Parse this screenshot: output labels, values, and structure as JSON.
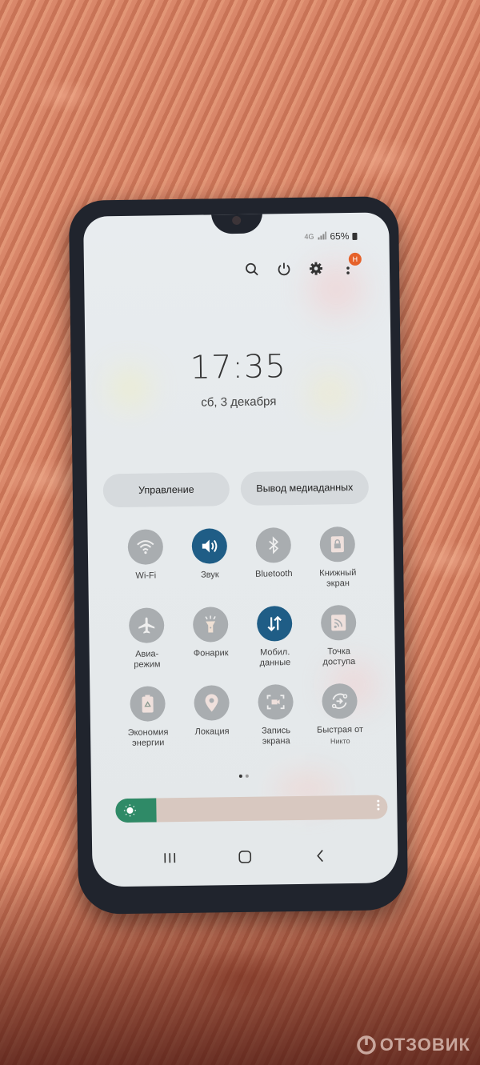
{
  "status_bar": {
    "network_type": "4G",
    "battery": "65%"
  },
  "top_icons": {
    "notification_badge": "H"
  },
  "clock": {
    "time": "17:35",
    "date": "сб, 3 декабря"
  },
  "pills": {
    "control": "Управление",
    "media_output": "Вывод медиаданных"
  },
  "tiles": [
    {
      "label": "Wi-Fi",
      "icon": "wifi-icon",
      "active": false
    },
    {
      "label": "Звук",
      "icon": "sound-icon",
      "active": true
    },
    {
      "label": "Bluetooth",
      "icon": "bluetooth-icon",
      "active": false
    },
    {
      "label": "Книжный\nэкран",
      "icon": "portrait-lock-icon",
      "active": false
    },
    {
      "label": "Авиа-\nрежим",
      "icon": "airplane-icon",
      "active": false
    },
    {
      "label": "Фонарик",
      "icon": "flashlight-icon",
      "active": false
    },
    {
      "label": "Мобил.\nданные",
      "icon": "mobile-data-icon",
      "active": true
    },
    {
      "label": "Точка\nдоступа",
      "icon": "hotspot-icon",
      "active": false
    },
    {
      "label": "Экономия\nэнергии",
      "icon": "power-saving-icon",
      "active": false
    },
    {
      "label": "Локация",
      "icon": "location-icon",
      "active": false
    },
    {
      "label": "Запись\nэкрана",
      "icon": "screen-record-icon",
      "active": false
    },
    {
      "label": "Быстрая от",
      "sublabel": "Никто",
      "icon": "quick-share-icon",
      "active": false
    }
  ],
  "pager": {
    "current": 1,
    "total": 2
  },
  "brightness": {
    "level": 0.15
  },
  "colors": {
    "active_tile": "#1f5d86",
    "inactive_tile": "#a9adb0",
    "brightness_fill": "#2f8a67",
    "badge": "#e6622b"
  },
  "watermark": "ОТЗОВИК"
}
